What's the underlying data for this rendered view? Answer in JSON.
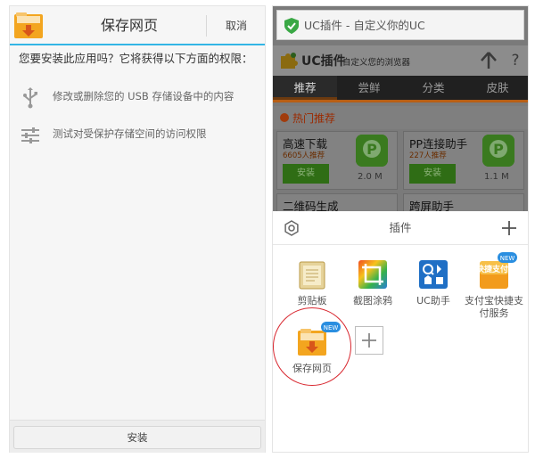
{
  "left_dialog": {
    "title": "保存网页",
    "cancel_label": "取消",
    "question": "您要安装此应用吗？它将获得以下方面的权限：",
    "permissions": [
      {
        "icon": "usb-icon",
        "text": "修改或删除您的 USB 存储设备中的内容"
      },
      {
        "icon": "sliders-icon",
        "text": "测试对受保护存储空间的访问权限"
      }
    ],
    "install_label": "安装"
  },
  "right_panel": {
    "url_bar": {
      "icon": "shield-check-icon",
      "text": "UC插件 - 自定义你的UC"
    },
    "header": {
      "brand": "UC插件",
      "slogan": "自定义您的浏览器"
    },
    "tabs": [
      {
        "label": "推荐",
        "active": true
      },
      {
        "label": "尝鲜",
        "active": false
      },
      {
        "label": "分类",
        "active": false
      },
      {
        "label": "皮肤",
        "active": false
      }
    ],
    "hot_section": "热门推荐",
    "apps": [
      {
        "name": "高速下载",
        "count": "6605人推荐",
        "install": "安装",
        "size": "2.0 M"
      },
      {
        "name": "PP连接助手",
        "count": "227人推荐",
        "install": "安装",
        "size": "1.1 M"
      },
      {
        "name": "二维码生成"
      },
      {
        "name": "跨屏助手"
      }
    ],
    "sheet": {
      "title": "插件",
      "plugins": [
        {
          "label": "剪贴板",
          "icon": "clipboard-icon"
        },
        {
          "label": "截图涂鸦",
          "icon": "crop-icon"
        },
        {
          "label": "UC助手",
          "icon": "uc-assistant-icon"
        },
        {
          "label": "支付宝快捷支付服务",
          "icon": "alipay-icon",
          "badge": "NEW",
          "icon_text": "快捷支付"
        },
        {
          "label": "保存网页",
          "icon": "save-page-icon",
          "badge": "NEW"
        }
      ]
    }
  },
  "colors": {
    "accent_blue": "#33b5e5",
    "install_green": "#2f6d15",
    "highlight_red": "#d8262e",
    "badge_blue": "#2a8ee0",
    "folder_orange": "#f3a51f"
  }
}
